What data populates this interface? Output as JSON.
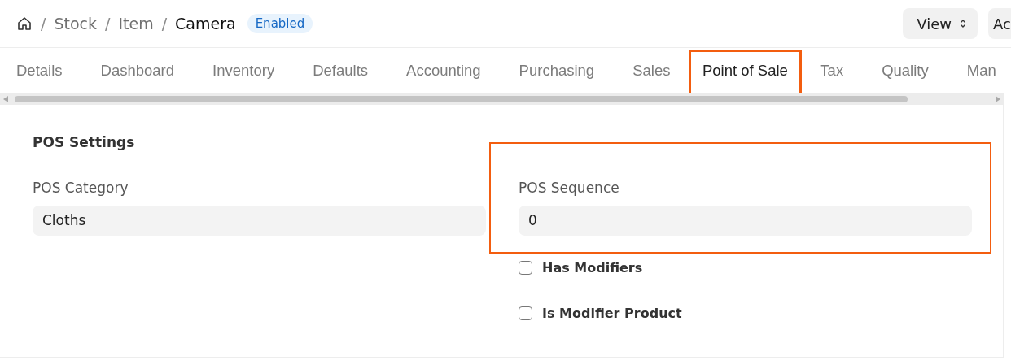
{
  "breadcrumb": [
    {
      "separator": "/",
      "label": "Stock",
      "kind": "link"
    },
    {
      "separator": "/",
      "label": "Item",
      "kind": "link"
    },
    {
      "separator": "/",
      "label": "Camera",
      "kind": "current"
    }
  ],
  "status_badge": "Enabled",
  "actions": [
    {
      "label": "View",
      "kind": "dropdown"
    },
    {
      "label": "Ac",
      "kind": "plain"
    }
  ],
  "tabs": [
    {
      "label": "Details",
      "selected": false,
      "highlighted": false
    },
    {
      "label": "Dashboard",
      "selected": false,
      "highlighted": false
    },
    {
      "label": "Inventory",
      "selected": false,
      "highlighted": false
    },
    {
      "label": "Defaults",
      "selected": false,
      "highlighted": false
    },
    {
      "label": "Accounting",
      "selected": false,
      "highlighted": false
    },
    {
      "label": "Purchasing",
      "selected": false,
      "highlighted": false
    },
    {
      "label": "Sales",
      "selected": false,
      "highlighted": false
    },
    {
      "label": "Point of Sale",
      "selected": true,
      "highlighted": true
    },
    {
      "label": "Tax",
      "selected": false,
      "highlighted": false
    },
    {
      "label": "Quality",
      "selected": false,
      "highlighted": false
    },
    {
      "label": "Man",
      "selected": false,
      "highlighted": false
    }
  ],
  "section": {
    "title": "POS Settings",
    "columns": [
      [
        {
          "kind": "field",
          "label": "POS Category",
          "value": "Cloths"
        }
      ],
      [
        {
          "kind": "field",
          "label": "POS Sequence",
          "value": "0",
          "highlighted": true
        },
        {
          "kind": "checkbox",
          "label": "Has Modifiers",
          "checked": false
        },
        {
          "kind": "checkbox",
          "label": "Is Modifier Product",
          "checked": false
        }
      ]
    ]
  }
}
